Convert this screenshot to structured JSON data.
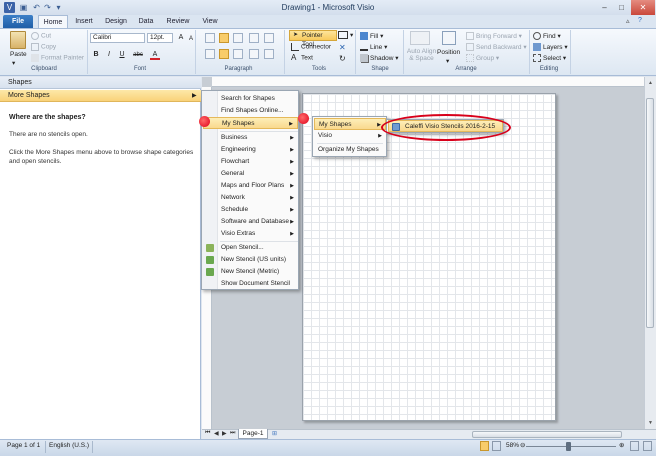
{
  "window": {
    "title": "Drawing1 - Microsoft Visio",
    "minimize": "–",
    "maximize": "□",
    "close": "✕"
  },
  "ribbon": {
    "file_tab": "File",
    "tabs": [
      "Home",
      "Insert",
      "Design",
      "Data",
      "Review",
      "View"
    ],
    "clipboard": {
      "label": "Clipboard",
      "paste": "Paste",
      "cut": "Cut",
      "copy": "Copy",
      "format_painter": "Format Painter"
    },
    "font": {
      "label": "Font",
      "font_name": "Calibri",
      "font_size": "12pt.",
      "bold": "B",
      "italic": "I",
      "underline": "U",
      "strike": "abc",
      "grow": "A",
      "shrink": "A",
      "color": "A"
    },
    "paragraph": {
      "label": "Paragraph"
    },
    "tools": {
      "label": "Tools",
      "pointer_tool": "Pointer Tool",
      "connector": "Connector",
      "text": "Text"
    },
    "shape": {
      "label": "Shape",
      "fill": "Fill",
      "line": "Line",
      "shadow": "Shadow"
    },
    "arrange": {
      "label": "Arrange",
      "auto_align": "Auto Align & Space",
      "position": "Position",
      "bring_forward": "Bring Forward",
      "send_backward": "Send Backward",
      "group": "Group"
    },
    "editing": {
      "label": "Editing",
      "find": "Find",
      "layers": "Layers",
      "select": "Select"
    }
  },
  "shapes_pane": {
    "header": "Shapes",
    "more_shapes": "More Shapes",
    "title": "Where are the shapes?",
    "no_stencils": "There are no stencils open.",
    "help": "Click the More Shapes menu above to browse shape categories and open stencils."
  },
  "more_shapes_menu": {
    "items": [
      "Search for Shapes",
      "Find Shapes Online...",
      "My Shapes",
      "Business",
      "Engineering",
      "Flowchart",
      "General",
      "Maps and Floor Plans",
      "Network",
      "Schedule",
      "Software and Database",
      "Visio Extras",
      "Open Stencil...",
      "New Stencil (US units)",
      "New Stencil (Metric)",
      "Show Document Stencil"
    ]
  },
  "my_shapes_menu": {
    "items": [
      "My Shapes",
      "Visio",
      "Organize My Shapes"
    ]
  },
  "my_shapes_submenu": {
    "item": "Caleffi Visio Stencils 2016-2-15"
  },
  "page_tabs": {
    "page": "Page-1"
  },
  "status_bar": {
    "page_info": "Page 1 of 1",
    "language": "English (U.S.)",
    "zoom": "58%"
  },
  "colors": {
    "accent": "#1f5ea7",
    "highlight": "#f9d98e",
    "annotation_red": "#d8001a"
  }
}
